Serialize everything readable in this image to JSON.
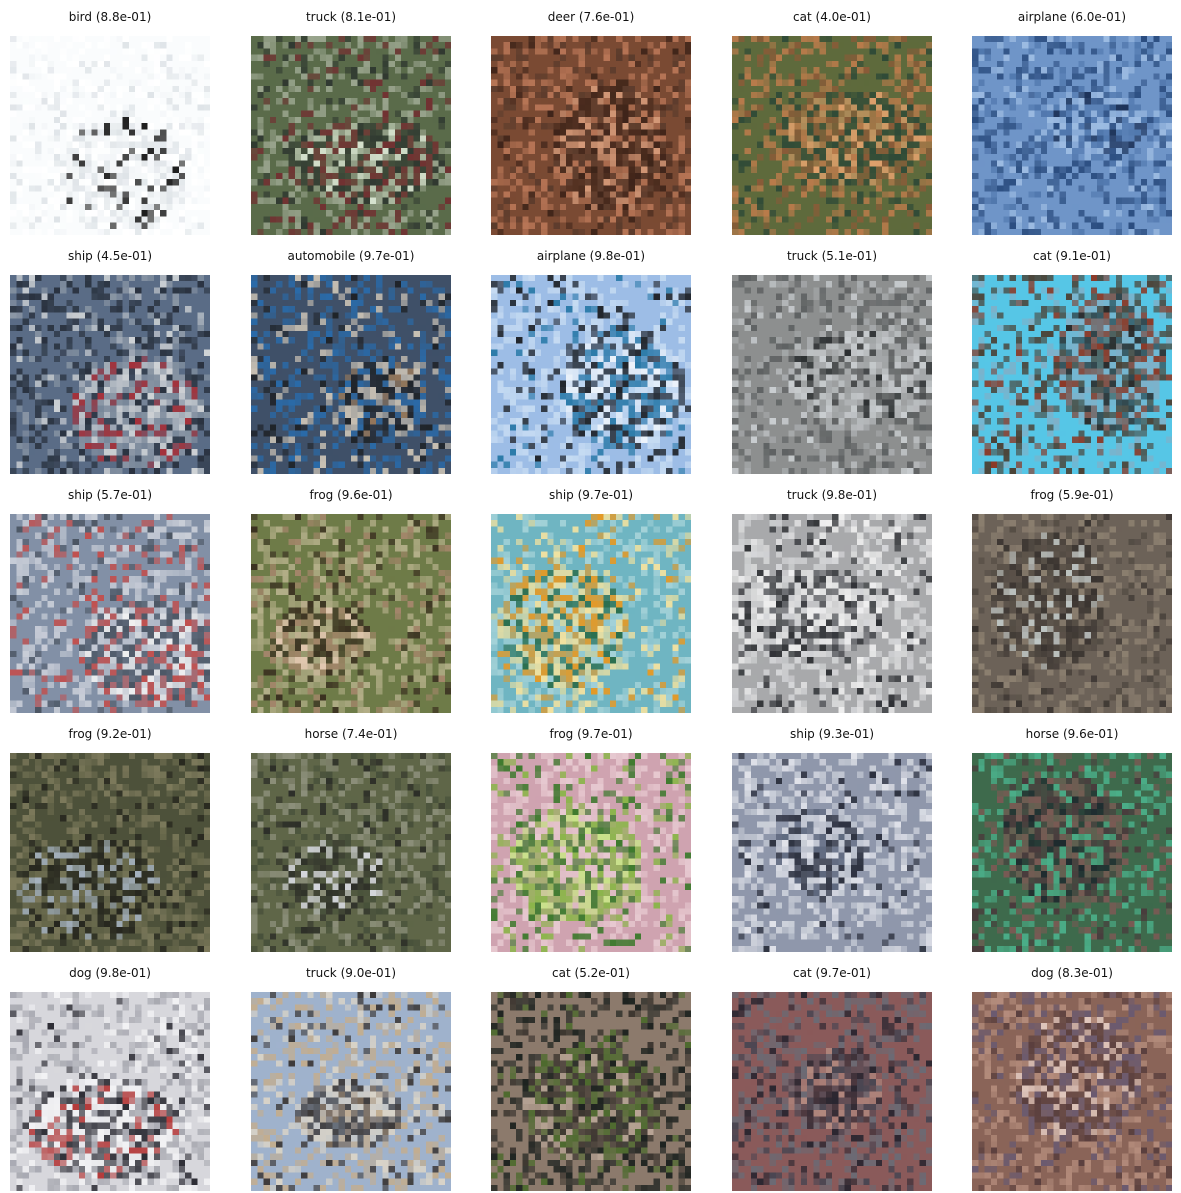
{
  "figure": {
    "rows": 5,
    "cols": 5,
    "panels": [
      {
        "label": "bird (8.8e-01)",
        "palette": [
          "#fafcfd",
          "#ffffff",
          "#f3f6f8",
          "#1b1b1b",
          "#dfe4e8"
        ],
        "subject": "bird-icon"
      },
      {
        "label": "truck (8.1e-01)",
        "palette": [
          "#5a6b4a",
          "#9aa58e",
          "#2f3830",
          "#d7e3cf",
          "#713232"
        ],
        "subject": "truck-icon"
      },
      {
        "label": "deer (7.6e-01)",
        "palette": [
          "#7a4a33",
          "#b77556",
          "#3e2419",
          "#d69b7a",
          "#5b3b2c"
        ],
        "subject": "deer-icon"
      },
      {
        "label": "cat (4.0e-01)",
        "palette": [
          "#5e6a3c",
          "#b97b4b",
          "#2f4a37",
          "#e0a16c",
          "#8a5b38"
        ],
        "subject": "cat-icon"
      },
      {
        "label": "airplane (6.0e-01)",
        "palette": [
          "#6f95c8",
          "#2b4d80",
          "#9dbce2",
          "#1a2f55",
          "#4f76ac"
        ],
        "subject": "airplane-icon"
      },
      {
        "label": "ship (4.5e-01)",
        "palette": [
          "#5a6c86",
          "#29323f",
          "#cfd3d6",
          "#a5313a",
          "#8c98a6"
        ],
        "subject": "ship-icon"
      },
      {
        "label": "automobile (9.7e-01)",
        "palette": [
          "#3f5068",
          "#2a6aa8",
          "#1f2328",
          "#9a7a5a",
          "#c9c1b4"
        ],
        "subject": "car-icon"
      },
      {
        "label": "airplane (9.8e-01)",
        "palette": [
          "#9dbde6",
          "#c6dbf2",
          "#2b7aa8",
          "#eef4fb",
          "#20242a"
        ],
        "subject": "airplane-icon"
      },
      {
        "label": "truck (5.1e-01)",
        "palette": [
          "#8d8f8f",
          "#5e6162",
          "#c9cdd0",
          "#2b2e30",
          "#a8abad"
        ],
        "subject": "truck-icon"
      },
      {
        "label": "cat (9.1e-01)",
        "palette": [
          "#56c6e6",
          "#4b4337",
          "#8b3a28",
          "#2b2b2b",
          "#7fb0c8"
        ],
        "subject": "cat-icon"
      },
      {
        "label": "ship (5.7e-01)",
        "palette": [
          "#8290a6",
          "#c9ced8",
          "#4b5563",
          "#f2f2f2",
          "#c05150"
        ],
        "subject": "ship-icon"
      },
      {
        "label": "frog (9.6e-01)",
        "palette": [
          "#6e7b48",
          "#b5b08a",
          "#3a3020",
          "#e4c9b2",
          "#a3866a"
        ],
        "subject": "frog-icon"
      },
      {
        "label": "ship (9.7e-01)",
        "palette": [
          "#6fb5c2",
          "#a4d2d8",
          "#e39a28",
          "#2b6e4e",
          "#f2e2a0"
        ],
        "subject": "ship-icon"
      },
      {
        "label": "truck (9.8e-01)",
        "palette": [
          "#a8a9ab",
          "#d6d7d9",
          "#2e3034",
          "#6d6f73",
          "#efefef"
        ],
        "subject": "truck-icon"
      },
      {
        "label": "frog (5.9e-01)",
        "palette": [
          "#6c6258",
          "#8c8070",
          "#3a3430",
          "#bfc6c4",
          "#544c44"
        ],
        "subject": "frog-icon"
      },
      {
        "label": "frog (9.2e-01)",
        "palette": [
          "#4d513a",
          "#7d7a5c",
          "#26261e",
          "#a6b3c0",
          "#6b6b4e"
        ],
        "subject": "frog-icon"
      },
      {
        "label": "horse (7.4e-01)",
        "palette": [
          "#5f6648",
          "#8c8f7a",
          "#2d2f28",
          "#d6d8de",
          "#47503a"
        ],
        "subject": "horse-icon"
      },
      {
        "label": "frog (9.7e-01)",
        "palette": [
          "#cfa3b0",
          "#e7c9d0",
          "#8bb54a",
          "#c9e28a",
          "#3e7a2e"
        ],
        "subject": "frog-icon"
      },
      {
        "label": "ship (9.3e-01)",
        "palette": [
          "#8f97ab",
          "#c9ced8",
          "#2b2f3d",
          "#5a647a",
          "#e1e3ea"
        ],
        "subject": "ship-icon"
      },
      {
        "label": "horse (9.6e-01)",
        "palette": [
          "#3e6a4c",
          "#4bb08a",
          "#4a3a3c",
          "#1e2a2e",
          "#7a5a54"
        ],
        "subject": "horse-icon"
      },
      {
        "label": "dog (9.8e-01)",
        "palette": [
          "#d7d7dc",
          "#a7a8b0",
          "#2c2c34",
          "#b53b3b",
          "#f2f2f4"
        ],
        "subject": "dog-icon"
      },
      {
        "label": "truck (9.0e-01)",
        "palette": [
          "#9fb2cc",
          "#c2ad90",
          "#3e3b3b",
          "#7a6a5a",
          "#d9d3c7"
        ],
        "subject": "truck-icon"
      },
      {
        "label": "cat (5.2e-01)",
        "palette": [
          "#8c7a6c",
          "#1e2320",
          "#4d6a2e",
          "#b8a596",
          "#3a342e"
        ],
        "subject": "cat-icon"
      },
      {
        "label": "cat (9.7e-01)",
        "palette": [
          "#8a5a5a",
          "#6b6a74",
          "#2a2630",
          "#b38a80",
          "#4a4652"
        ],
        "subject": "cat-icon"
      },
      {
        "label": "dog (8.3e-01)",
        "palette": [
          "#8a6458",
          "#b48c7c",
          "#5a3f3e",
          "#e0c7bd",
          "#6a5a70"
        ],
        "subject": "dog-icon"
      }
    ]
  }
}
